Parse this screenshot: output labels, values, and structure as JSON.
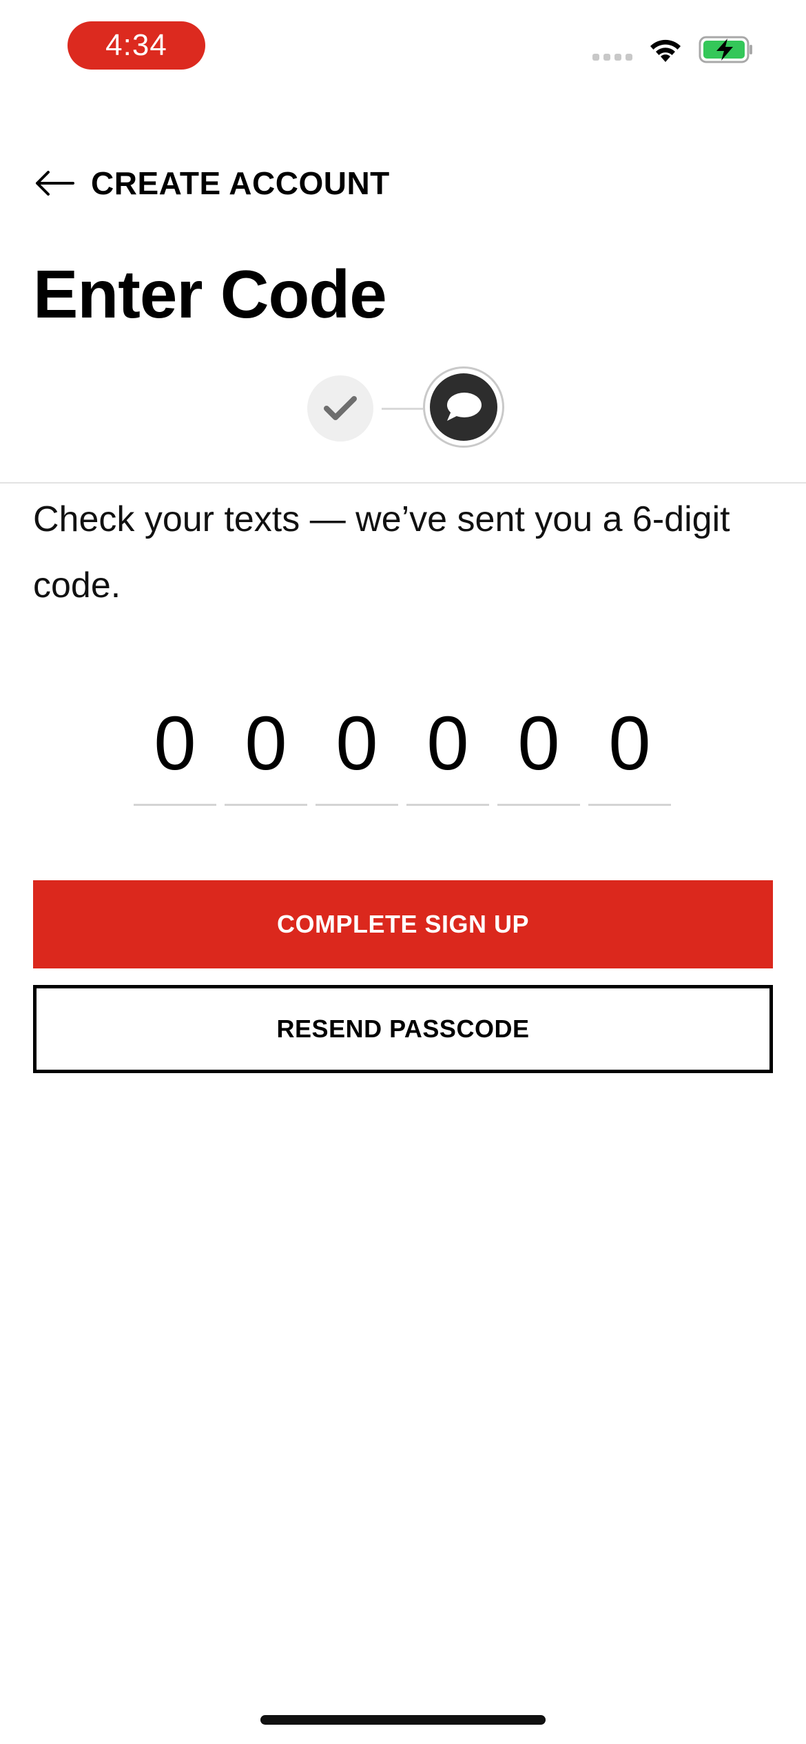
{
  "status_bar": {
    "time": "4:34"
  },
  "header": {
    "back_label": "CREATE ACCOUNT",
    "title": "Enter Code"
  },
  "stepper": {
    "steps": [
      {
        "state": "completed",
        "icon": "checkmark-icon"
      },
      {
        "state": "current",
        "icon": "chat-bubble-icon"
      }
    ]
  },
  "instructions": "Check your texts — we’ve sent you a 6-digit code.",
  "code": {
    "digits": [
      "0",
      "0",
      "0",
      "0",
      "0",
      "0"
    ]
  },
  "buttons": {
    "primary_label": "COMPLETE SIGN UP",
    "secondary_label": "RESEND PASSCODE"
  },
  "colors": {
    "accent": "#db281d",
    "text": "#000000",
    "step_current_bg": "#2d2d2d",
    "step_done_bg": "#efefef"
  }
}
